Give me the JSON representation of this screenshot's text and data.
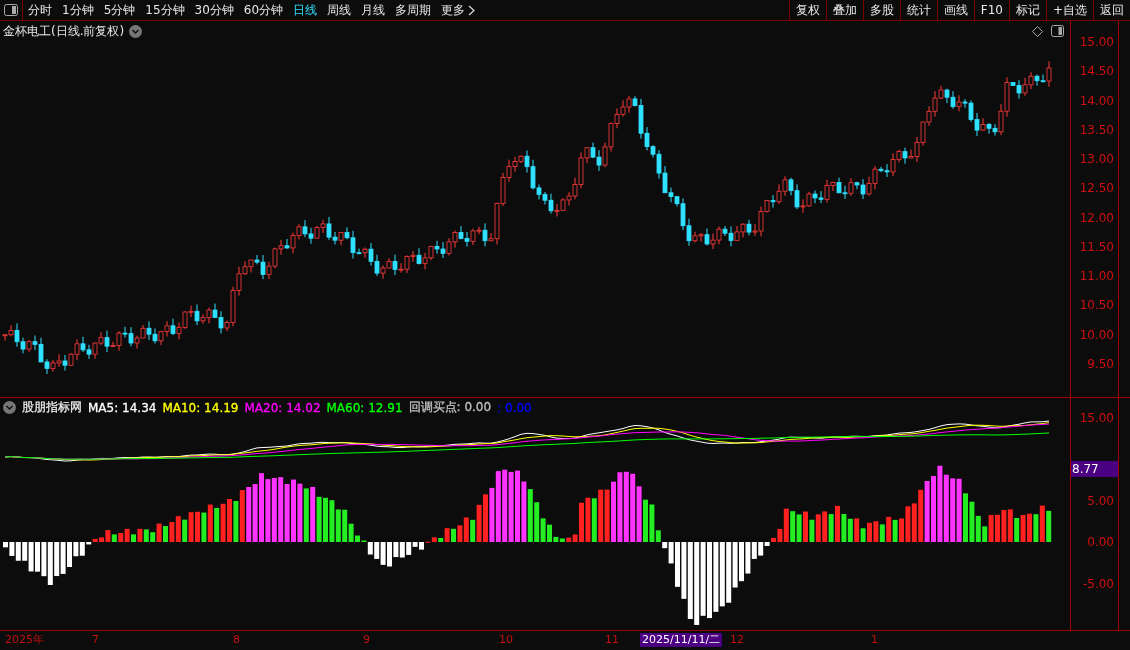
{
  "toolbar": {
    "periods": [
      {
        "label": "分时",
        "selected": false
      },
      {
        "label": "1分钟",
        "selected": false
      },
      {
        "label": "5分钟",
        "selected": false
      },
      {
        "label": "15分钟",
        "selected": false
      },
      {
        "label": "30分钟",
        "selected": false
      },
      {
        "label": "60分钟",
        "selected": false
      },
      {
        "label": "日线",
        "selected": true
      },
      {
        "label": "周线",
        "selected": false
      },
      {
        "label": "月线",
        "selected": false
      },
      {
        "label": "多周期",
        "selected": false
      },
      {
        "label": "更多",
        "selected": false
      }
    ],
    "actions": [
      "复权",
      "叠加",
      "多股",
      "统计",
      "画线",
      "F10",
      "标记",
      "+自选",
      "返回"
    ]
  },
  "main_chart": {
    "title": "金杯电工(日线.前复权)",
    "price_ticks": [
      "15.00",
      "14.50",
      "14.00",
      "13.50",
      "13.00",
      "12.50",
      "12.00",
      "11.50",
      "11.00",
      "10.50",
      "10.00",
      "9.50"
    ]
  },
  "indicator": {
    "name": "股朋指标网",
    "legend": [
      {
        "label": "MA5: 14.34",
        "color": "#ffffff"
      },
      {
        "label": "MA10: 14.19",
        "color": "#ffff00"
      },
      {
        "label": "MA20: 14.02",
        "color": "#ff00ff"
      },
      {
        "label": "MA60: 12.91",
        "color": "#00ff00"
      },
      {
        "label": "回调买点: 0.00",
        "color": "#c0c0c0"
      },
      {
        "label": ": 0.00",
        "color": "#0000ff"
      }
    ],
    "ticks": [
      "15.00",
      "5.00",
      "0.00",
      "-5.00"
    ],
    "cursor_value": "8.77"
  },
  "date_axis": {
    "labels": [
      {
        "label": "2025年",
        "cursor": false
      },
      {
        "label": "7",
        "cursor": false
      },
      {
        "label": "8",
        "cursor": false
      },
      {
        "label": "9",
        "cursor": false
      },
      {
        "label": "10",
        "cursor": false
      },
      {
        "label": "11",
        "cursor": false
      },
      {
        "label": "2025/11/11/二",
        "cursor": true
      },
      {
        "label": "12",
        "cursor": false
      },
      {
        "label": "1",
        "cursor": false
      }
    ]
  }
}
